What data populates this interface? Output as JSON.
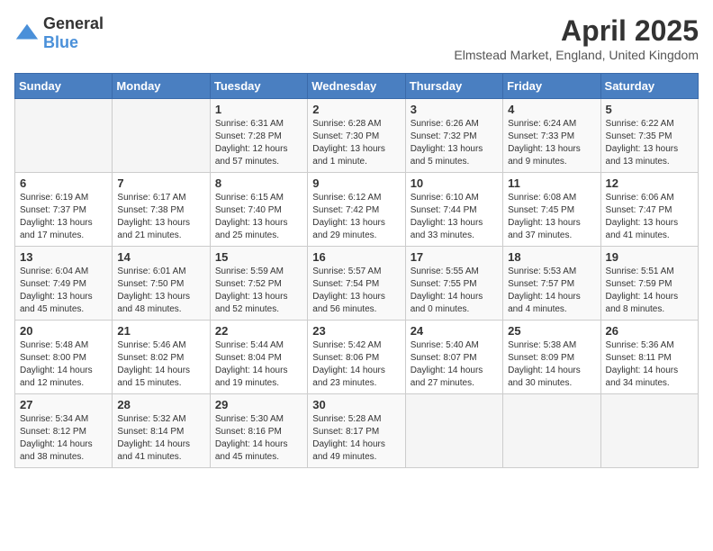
{
  "header": {
    "logo": {
      "general": "General",
      "blue": "Blue"
    },
    "title": "April 2025",
    "subtitle": "Elmstead Market, England, United Kingdom"
  },
  "days_of_week": [
    "Sunday",
    "Monday",
    "Tuesday",
    "Wednesday",
    "Thursday",
    "Friday",
    "Saturday"
  ],
  "weeks": [
    [
      {
        "day": "",
        "info": ""
      },
      {
        "day": "",
        "info": ""
      },
      {
        "day": "1",
        "info": "Sunrise: 6:31 AM\nSunset: 7:28 PM\nDaylight: 12 hours and 57 minutes."
      },
      {
        "day": "2",
        "info": "Sunrise: 6:28 AM\nSunset: 7:30 PM\nDaylight: 13 hours and 1 minute."
      },
      {
        "day": "3",
        "info": "Sunrise: 6:26 AM\nSunset: 7:32 PM\nDaylight: 13 hours and 5 minutes."
      },
      {
        "day": "4",
        "info": "Sunrise: 6:24 AM\nSunset: 7:33 PM\nDaylight: 13 hours and 9 minutes."
      },
      {
        "day": "5",
        "info": "Sunrise: 6:22 AM\nSunset: 7:35 PM\nDaylight: 13 hours and 13 minutes."
      }
    ],
    [
      {
        "day": "6",
        "info": "Sunrise: 6:19 AM\nSunset: 7:37 PM\nDaylight: 13 hours and 17 minutes."
      },
      {
        "day": "7",
        "info": "Sunrise: 6:17 AM\nSunset: 7:38 PM\nDaylight: 13 hours and 21 minutes."
      },
      {
        "day": "8",
        "info": "Sunrise: 6:15 AM\nSunset: 7:40 PM\nDaylight: 13 hours and 25 minutes."
      },
      {
        "day": "9",
        "info": "Sunrise: 6:12 AM\nSunset: 7:42 PM\nDaylight: 13 hours and 29 minutes."
      },
      {
        "day": "10",
        "info": "Sunrise: 6:10 AM\nSunset: 7:44 PM\nDaylight: 13 hours and 33 minutes."
      },
      {
        "day": "11",
        "info": "Sunrise: 6:08 AM\nSunset: 7:45 PM\nDaylight: 13 hours and 37 minutes."
      },
      {
        "day": "12",
        "info": "Sunrise: 6:06 AM\nSunset: 7:47 PM\nDaylight: 13 hours and 41 minutes."
      }
    ],
    [
      {
        "day": "13",
        "info": "Sunrise: 6:04 AM\nSunset: 7:49 PM\nDaylight: 13 hours and 45 minutes."
      },
      {
        "day": "14",
        "info": "Sunrise: 6:01 AM\nSunset: 7:50 PM\nDaylight: 13 hours and 48 minutes."
      },
      {
        "day": "15",
        "info": "Sunrise: 5:59 AM\nSunset: 7:52 PM\nDaylight: 13 hours and 52 minutes."
      },
      {
        "day": "16",
        "info": "Sunrise: 5:57 AM\nSunset: 7:54 PM\nDaylight: 13 hours and 56 minutes."
      },
      {
        "day": "17",
        "info": "Sunrise: 5:55 AM\nSunset: 7:55 PM\nDaylight: 14 hours and 0 minutes."
      },
      {
        "day": "18",
        "info": "Sunrise: 5:53 AM\nSunset: 7:57 PM\nDaylight: 14 hours and 4 minutes."
      },
      {
        "day": "19",
        "info": "Sunrise: 5:51 AM\nSunset: 7:59 PM\nDaylight: 14 hours and 8 minutes."
      }
    ],
    [
      {
        "day": "20",
        "info": "Sunrise: 5:48 AM\nSunset: 8:00 PM\nDaylight: 14 hours and 12 minutes."
      },
      {
        "day": "21",
        "info": "Sunrise: 5:46 AM\nSunset: 8:02 PM\nDaylight: 14 hours and 15 minutes."
      },
      {
        "day": "22",
        "info": "Sunrise: 5:44 AM\nSunset: 8:04 PM\nDaylight: 14 hours and 19 minutes."
      },
      {
        "day": "23",
        "info": "Sunrise: 5:42 AM\nSunset: 8:06 PM\nDaylight: 14 hours and 23 minutes."
      },
      {
        "day": "24",
        "info": "Sunrise: 5:40 AM\nSunset: 8:07 PM\nDaylight: 14 hours and 27 minutes."
      },
      {
        "day": "25",
        "info": "Sunrise: 5:38 AM\nSunset: 8:09 PM\nDaylight: 14 hours and 30 minutes."
      },
      {
        "day": "26",
        "info": "Sunrise: 5:36 AM\nSunset: 8:11 PM\nDaylight: 14 hours and 34 minutes."
      }
    ],
    [
      {
        "day": "27",
        "info": "Sunrise: 5:34 AM\nSunset: 8:12 PM\nDaylight: 14 hours and 38 minutes."
      },
      {
        "day": "28",
        "info": "Sunrise: 5:32 AM\nSunset: 8:14 PM\nDaylight: 14 hours and 41 minutes."
      },
      {
        "day": "29",
        "info": "Sunrise: 5:30 AM\nSunset: 8:16 PM\nDaylight: 14 hours and 45 minutes."
      },
      {
        "day": "30",
        "info": "Sunrise: 5:28 AM\nSunset: 8:17 PM\nDaylight: 14 hours and 49 minutes."
      },
      {
        "day": "",
        "info": ""
      },
      {
        "day": "",
        "info": ""
      },
      {
        "day": "",
        "info": ""
      }
    ]
  ]
}
